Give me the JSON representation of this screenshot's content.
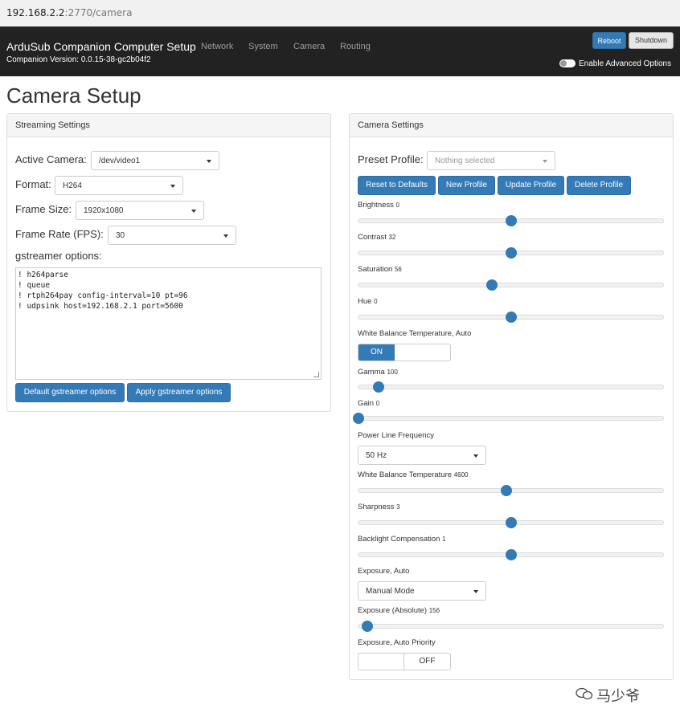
{
  "browser": {
    "url_host": "192.168.2.2",
    "url_path": ":2770/camera"
  },
  "navbar": {
    "brand": "ArduSub Companion Computer Setup",
    "version": "Companion Version: 0.0.15-38-gc2b04f2",
    "links": [
      "Network",
      "System",
      "Camera",
      "Routing"
    ],
    "reboot": "Reboot",
    "shutdown": "Shutdown",
    "advanced": "Enable Advanced Options"
  },
  "page": {
    "title": "Camera Setup"
  },
  "streaming": {
    "heading": "Streaming Settings",
    "active_camera_label": "Active Camera:",
    "active_camera": "/dev/video1",
    "format_label": "Format:",
    "format": "H264",
    "frame_size_label": "Frame Size:",
    "frame_size": "1920x1080",
    "frame_rate_label": "Frame Rate (FPS):",
    "frame_rate": "30",
    "gst_label": "gstreamer options:",
    "gst_lines": [
      "! h264parse",
      "! queue",
      "! rtph264pay config-interval=10 pt=96",
      "! udpsink host=192.168.2.1 port=5600"
    ],
    "default_btn": "Default gstreamer options",
    "apply_btn": "Apply gstreamer options"
  },
  "camera": {
    "heading": "Camera Settings",
    "preset_label": "Preset Profile:",
    "preset_placeholder": "Nothing selected",
    "reset_btn": "Reset to Defaults",
    "new_btn": "New Profile",
    "update_btn": "Update Profile",
    "delete_btn": "Delete Profile",
    "sliders": [
      {
        "label": "Brightness",
        "value": "0",
        "fraction": 0.5
      },
      {
        "label": "Contrast",
        "value": "32",
        "fraction": 0.5
      },
      {
        "label": "Saturation",
        "value": "56",
        "fraction": 0.438
      },
      {
        "label": "Hue",
        "value": "0",
        "fraction": 0.5
      },
      {
        "label": "Gamma",
        "value": "100",
        "fraction": 0.066
      },
      {
        "label": "Gain",
        "value": "0",
        "fraction": 0.0
      },
      {
        "label": "White Balance Temperature",
        "value": "4600",
        "fraction": 0.486
      },
      {
        "label": "Sharpness",
        "value": "3",
        "fraction": 0.5
      },
      {
        "label": "Backlight Compensation",
        "value": "1",
        "fraction": 0.5
      },
      {
        "label": "Exposure (Absolute)",
        "value": "156",
        "fraction": 0.03
      }
    ],
    "wb_auto_label": "White Balance Temperature, Auto",
    "wb_auto_state": "ON",
    "power_line_label": "Power Line Frequency",
    "power_line": "50 Hz",
    "exposure_auto_label": "Exposure, Auto",
    "exposure_auto": "Manual Mode",
    "exposure_priority_label": "Exposure, Auto Priority",
    "exposure_priority_state": "OFF"
  },
  "watermark": "马少爷",
  "colors": {
    "primary": "#337ab7",
    "navbar": "#222222",
    "panel_head": "#f5f5f5"
  }
}
